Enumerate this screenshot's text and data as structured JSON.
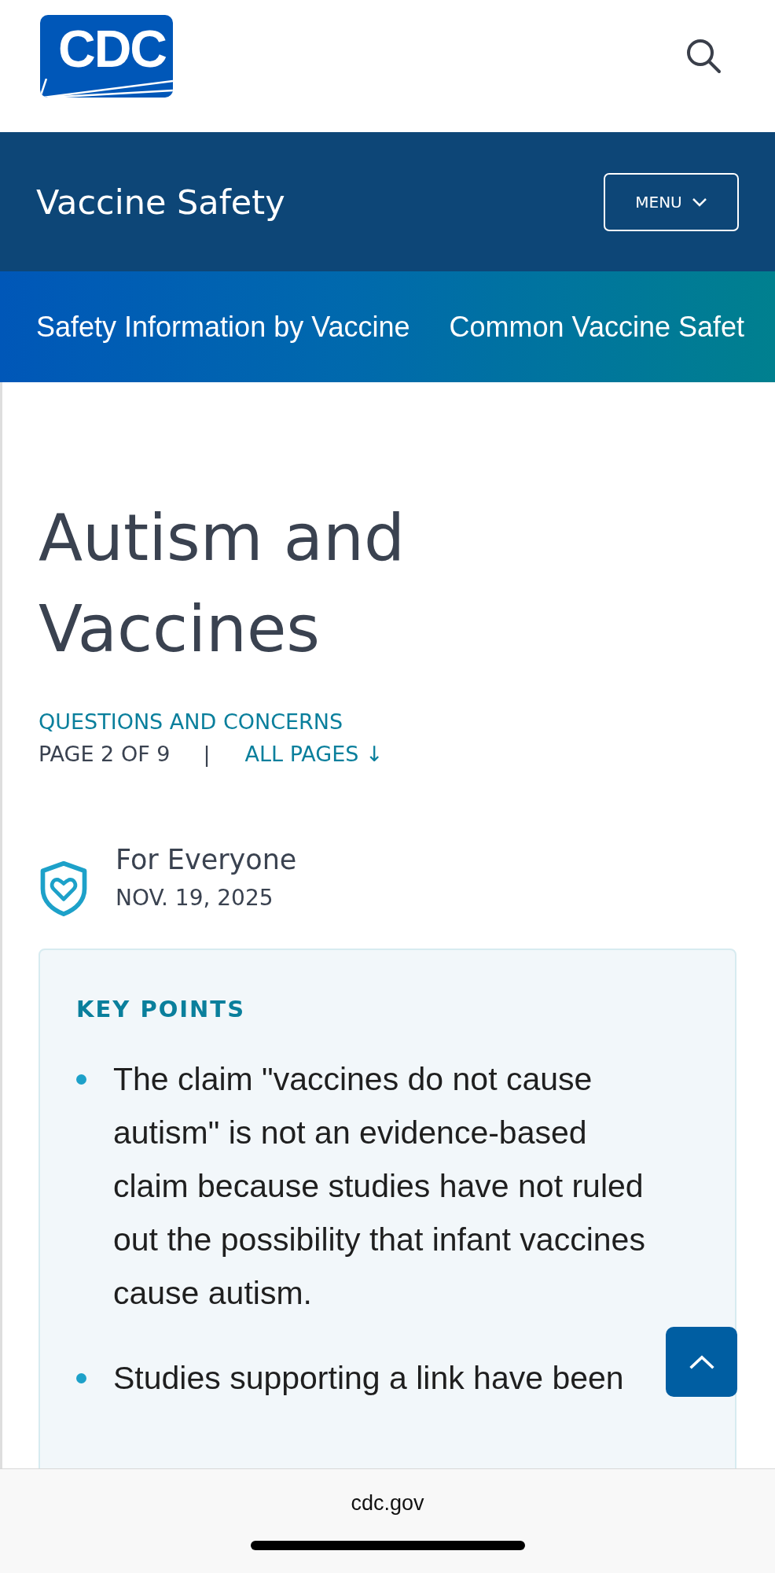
{
  "header": {
    "logo_text": "CDC"
  },
  "site_bar": {
    "title": "Vaccine Safety",
    "menu_button": "MENU"
  },
  "nav": {
    "items": [
      {
        "label": "Safety Information by Vaccine"
      },
      {
        "label": "Common Vaccine Safet"
      }
    ]
  },
  "article": {
    "title": "Autism and Vaccines",
    "series": "QUESTIONS AND CONCERNS",
    "page_indicator": "PAGE 2 OF 9",
    "separator": "|",
    "all_pages_link": "ALL PAGES ↓",
    "audience": "For Everyone",
    "date": "NOV. 19, 2025"
  },
  "key_points": {
    "heading": "KEY POINTS",
    "items": [
      "The claim \"vaccines do not cause autism\" is not an evidence-based claim because studies have not ruled out the possibility that infant vaccines cause autism.",
      "Studies supporting a link have been"
    ]
  },
  "browser_bar": {
    "url": "cdc.gov"
  }
}
